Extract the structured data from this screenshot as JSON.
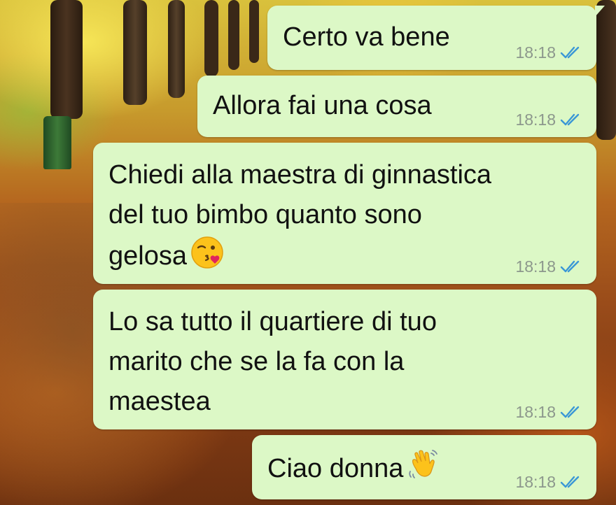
{
  "colors": {
    "bubble_background": "#dcf8c6",
    "text": "#111111",
    "timestamp": "#8c978c",
    "read_ticks": "#3a97d6"
  },
  "messages": [
    {
      "text": "Certo va bene",
      "time": "18:18",
      "status": "read",
      "has_tail": true
    },
    {
      "text": "Allora fai una cosa",
      "time": "18:18",
      "status": "read"
    },
    {
      "text": "Chiedi alla maestra di ginnastica\ndel tuo bimbo quanto sono\ngelosa",
      "emoji": "face-blowing-a-kiss-icon",
      "time": "18:18",
      "status": "read"
    },
    {
      "text": "Lo sa tutto il quartiere di tuo\nmarito che se la fa con la\nmaestea",
      "time": "18:18",
      "status": "read"
    },
    {
      "text": "Ciao donna",
      "emoji": "waving-hand-icon",
      "time": "18:18",
      "status": "read"
    }
  ]
}
